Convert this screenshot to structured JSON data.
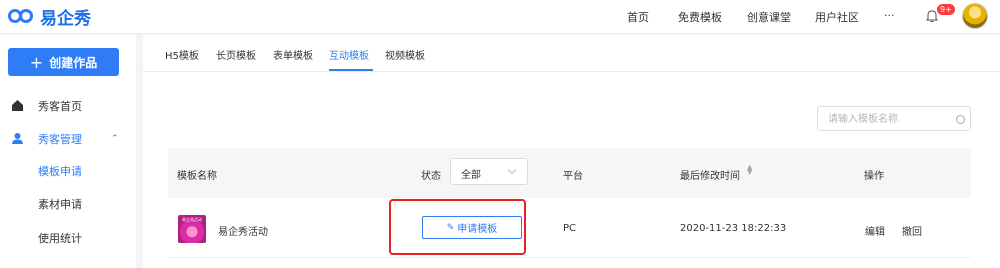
{
  "brand": {
    "name": "易企秀"
  },
  "topnav": {
    "items": [
      "首页",
      "免费模板",
      "创意课堂",
      "用户社区",
      "···"
    ],
    "badge": "9+"
  },
  "sidebar": {
    "create_label": "创建作品",
    "items": [
      {
        "label": "秀客首页"
      },
      {
        "label": "秀客管理"
      },
      {
        "label": "模板申请"
      },
      {
        "label": "素材申请"
      },
      {
        "label": "使用统计"
      }
    ]
  },
  "tabs": [
    "H5模板",
    "长页模板",
    "表单模板",
    "互动模板",
    "视频模板"
  ],
  "search": {
    "placeholder": "请输入模板名称"
  },
  "table": {
    "headers": {
      "name": "模板名称",
      "status": "状态",
      "platform": "平台",
      "modified": "最后修改时间",
      "actions": "操作"
    },
    "status_filter": "全部",
    "rows": [
      {
        "name": "易企秀活动",
        "apply_label": "申请模板",
        "platform": "PC",
        "modified": "2020-11-23 18:22:33",
        "edit": "编辑",
        "revoke": "撤回"
      }
    ]
  },
  "colors": {
    "accent": "#2f7df6",
    "highlight": "#e8231f"
  }
}
